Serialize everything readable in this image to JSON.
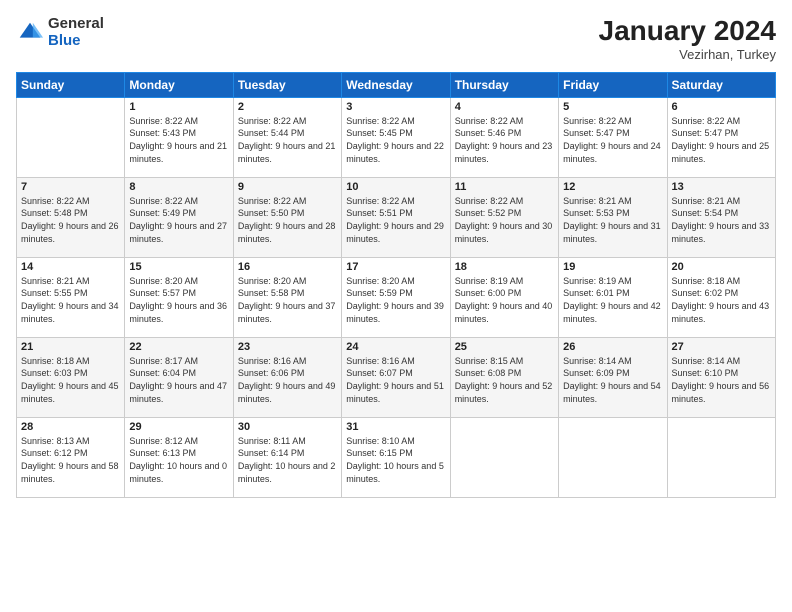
{
  "header": {
    "logo_line1": "General",
    "logo_line2": "Blue",
    "month_title": "January 2024",
    "location": "Vezirhan, Turkey"
  },
  "days_of_week": [
    "Sunday",
    "Monday",
    "Tuesday",
    "Wednesday",
    "Thursday",
    "Friday",
    "Saturday"
  ],
  "weeks": [
    [
      {
        "day": "",
        "sunrise": "",
        "sunset": "",
        "daylight": ""
      },
      {
        "day": "1",
        "sunrise": "Sunrise: 8:22 AM",
        "sunset": "Sunset: 5:43 PM",
        "daylight": "Daylight: 9 hours and 21 minutes."
      },
      {
        "day": "2",
        "sunrise": "Sunrise: 8:22 AM",
        "sunset": "Sunset: 5:44 PM",
        "daylight": "Daylight: 9 hours and 21 minutes."
      },
      {
        "day": "3",
        "sunrise": "Sunrise: 8:22 AM",
        "sunset": "Sunset: 5:45 PM",
        "daylight": "Daylight: 9 hours and 22 minutes."
      },
      {
        "day": "4",
        "sunrise": "Sunrise: 8:22 AM",
        "sunset": "Sunset: 5:46 PM",
        "daylight": "Daylight: 9 hours and 23 minutes."
      },
      {
        "day": "5",
        "sunrise": "Sunrise: 8:22 AM",
        "sunset": "Sunset: 5:47 PM",
        "daylight": "Daylight: 9 hours and 24 minutes."
      },
      {
        "day": "6",
        "sunrise": "Sunrise: 8:22 AM",
        "sunset": "Sunset: 5:47 PM",
        "daylight": "Daylight: 9 hours and 25 minutes."
      }
    ],
    [
      {
        "day": "7",
        "sunrise": "Sunrise: 8:22 AM",
        "sunset": "Sunset: 5:48 PM",
        "daylight": "Daylight: 9 hours and 26 minutes."
      },
      {
        "day": "8",
        "sunrise": "Sunrise: 8:22 AM",
        "sunset": "Sunset: 5:49 PM",
        "daylight": "Daylight: 9 hours and 27 minutes."
      },
      {
        "day": "9",
        "sunrise": "Sunrise: 8:22 AM",
        "sunset": "Sunset: 5:50 PM",
        "daylight": "Daylight: 9 hours and 28 minutes."
      },
      {
        "day": "10",
        "sunrise": "Sunrise: 8:22 AM",
        "sunset": "Sunset: 5:51 PM",
        "daylight": "Daylight: 9 hours and 29 minutes."
      },
      {
        "day": "11",
        "sunrise": "Sunrise: 8:22 AM",
        "sunset": "Sunset: 5:52 PM",
        "daylight": "Daylight: 9 hours and 30 minutes."
      },
      {
        "day": "12",
        "sunrise": "Sunrise: 8:21 AM",
        "sunset": "Sunset: 5:53 PM",
        "daylight": "Daylight: 9 hours and 31 minutes."
      },
      {
        "day": "13",
        "sunrise": "Sunrise: 8:21 AM",
        "sunset": "Sunset: 5:54 PM",
        "daylight": "Daylight: 9 hours and 33 minutes."
      }
    ],
    [
      {
        "day": "14",
        "sunrise": "Sunrise: 8:21 AM",
        "sunset": "Sunset: 5:55 PM",
        "daylight": "Daylight: 9 hours and 34 minutes."
      },
      {
        "day": "15",
        "sunrise": "Sunrise: 8:20 AM",
        "sunset": "Sunset: 5:57 PM",
        "daylight": "Daylight: 9 hours and 36 minutes."
      },
      {
        "day": "16",
        "sunrise": "Sunrise: 8:20 AM",
        "sunset": "Sunset: 5:58 PM",
        "daylight": "Daylight: 9 hours and 37 minutes."
      },
      {
        "day": "17",
        "sunrise": "Sunrise: 8:20 AM",
        "sunset": "Sunset: 5:59 PM",
        "daylight": "Daylight: 9 hours and 39 minutes."
      },
      {
        "day": "18",
        "sunrise": "Sunrise: 8:19 AM",
        "sunset": "Sunset: 6:00 PM",
        "daylight": "Daylight: 9 hours and 40 minutes."
      },
      {
        "day": "19",
        "sunrise": "Sunrise: 8:19 AM",
        "sunset": "Sunset: 6:01 PM",
        "daylight": "Daylight: 9 hours and 42 minutes."
      },
      {
        "day": "20",
        "sunrise": "Sunrise: 8:18 AM",
        "sunset": "Sunset: 6:02 PM",
        "daylight": "Daylight: 9 hours and 43 minutes."
      }
    ],
    [
      {
        "day": "21",
        "sunrise": "Sunrise: 8:18 AM",
        "sunset": "Sunset: 6:03 PM",
        "daylight": "Daylight: 9 hours and 45 minutes."
      },
      {
        "day": "22",
        "sunrise": "Sunrise: 8:17 AM",
        "sunset": "Sunset: 6:04 PM",
        "daylight": "Daylight: 9 hours and 47 minutes."
      },
      {
        "day": "23",
        "sunrise": "Sunrise: 8:16 AM",
        "sunset": "Sunset: 6:06 PM",
        "daylight": "Daylight: 9 hours and 49 minutes."
      },
      {
        "day": "24",
        "sunrise": "Sunrise: 8:16 AM",
        "sunset": "Sunset: 6:07 PM",
        "daylight": "Daylight: 9 hours and 51 minutes."
      },
      {
        "day": "25",
        "sunrise": "Sunrise: 8:15 AM",
        "sunset": "Sunset: 6:08 PM",
        "daylight": "Daylight: 9 hours and 52 minutes."
      },
      {
        "day": "26",
        "sunrise": "Sunrise: 8:14 AM",
        "sunset": "Sunset: 6:09 PM",
        "daylight": "Daylight: 9 hours and 54 minutes."
      },
      {
        "day": "27",
        "sunrise": "Sunrise: 8:14 AM",
        "sunset": "Sunset: 6:10 PM",
        "daylight": "Daylight: 9 hours and 56 minutes."
      }
    ],
    [
      {
        "day": "28",
        "sunrise": "Sunrise: 8:13 AM",
        "sunset": "Sunset: 6:12 PM",
        "daylight": "Daylight: 9 hours and 58 minutes."
      },
      {
        "day": "29",
        "sunrise": "Sunrise: 8:12 AM",
        "sunset": "Sunset: 6:13 PM",
        "daylight": "Daylight: 10 hours and 0 minutes."
      },
      {
        "day": "30",
        "sunrise": "Sunrise: 8:11 AM",
        "sunset": "Sunset: 6:14 PM",
        "daylight": "Daylight: 10 hours and 2 minutes."
      },
      {
        "day": "31",
        "sunrise": "Sunrise: 8:10 AM",
        "sunset": "Sunset: 6:15 PM",
        "daylight": "Daylight: 10 hours and 5 minutes."
      },
      {
        "day": "",
        "sunrise": "",
        "sunset": "",
        "daylight": ""
      },
      {
        "day": "",
        "sunrise": "",
        "sunset": "",
        "daylight": ""
      },
      {
        "day": "",
        "sunrise": "",
        "sunset": "",
        "daylight": ""
      }
    ]
  ]
}
